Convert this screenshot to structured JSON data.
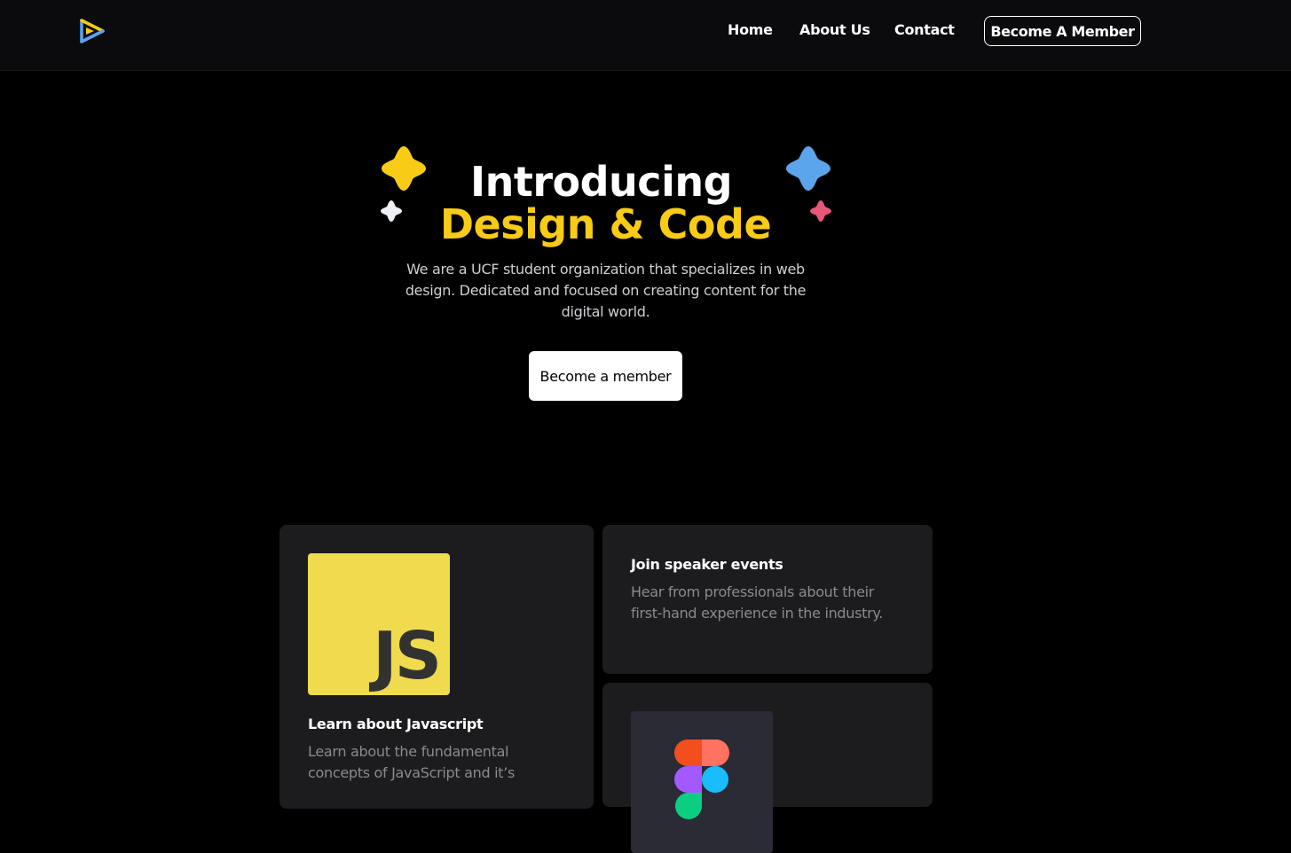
{
  "nav": {
    "links": [
      "Home",
      "About Us",
      "Contact"
    ],
    "cta_label": "Become A Member"
  },
  "hero": {
    "line1": "Introducing",
    "line2": "Design & Code",
    "description": "We are a UCF student organization that specializes in web design. Dedicated and focused on creating content for the digital world.",
    "button_label": "Become a member"
  },
  "cards": {
    "javascript": {
      "logo_text": "JS",
      "title": "Learn about Javascript",
      "description": "Learn about the fundamental concepts of JavaScript and it’s"
    },
    "speaker": {
      "title": "Join speaker events",
      "description": "Hear from professionals about their first-hand experience in the industry."
    },
    "figma": {
      "icon": "figma-logo-icon"
    }
  },
  "colors": {
    "accent_yellow": "#f8cb17",
    "accent_blue": "#5aa5ec",
    "accent_pink": "#e8577a",
    "background": "#000000",
    "card_background": "#1c1c1e"
  }
}
